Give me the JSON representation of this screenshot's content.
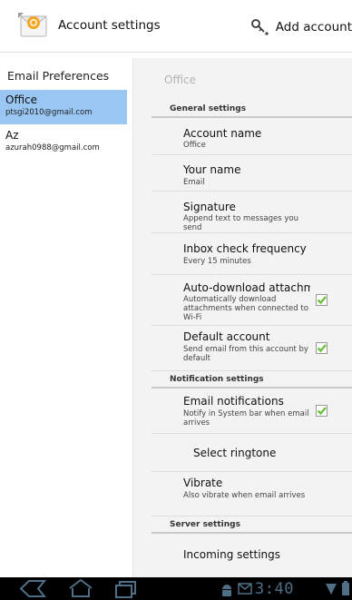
{
  "action_bar": {
    "title": "Account settings",
    "add_account_label": "Add account",
    "app_icon": "email-app-icon",
    "add_icon": "key-plus-icon"
  },
  "sidebar": {
    "heading": "Email Preferences",
    "accounts": [
      {
        "name": "Office",
        "email": "ptsgi2010@gmail.com",
        "selected": true
      },
      {
        "name": "Az",
        "email": "azurah0988@gmail.com",
        "selected": false
      }
    ]
  },
  "settings": {
    "pane_title": "Office",
    "general_header": "General settings",
    "account_name": {
      "title": "Account name",
      "summary": "Office"
    },
    "your_name": {
      "title": "Your name",
      "summary": "Email"
    },
    "signature": {
      "title": "Signature",
      "summary": "Append text to messages you send"
    },
    "inbox_check": {
      "title": "Inbox check frequency",
      "summary": "Every 15 minutes"
    },
    "auto_download": {
      "title": "Auto-download attachm",
      "summary": "Automatically download attachments when connected to Wi-Fi",
      "checked": true
    },
    "default_account": {
      "title": "Default account",
      "summary": "Send email from this account by default",
      "checked": true
    },
    "notification_header": "Notification settings",
    "email_notifications": {
      "title": "Email notifications",
      "summary": "Notify in System bar when email arrives",
      "checked": true
    },
    "select_ringtone": {
      "title": "Select ringtone"
    },
    "vibrate": {
      "title": "Vibrate",
      "summary": "Also vibrate when email arrives"
    },
    "server_header": "Server settings",
    "incoming": {
      "title": "Incoming settings"
    }
  },
  "nav_bar": {
    "time": "3:40",
    "icons": [
      "back-icon",
      "home-icon",
      "recent-apps-icon",
      "android-notification-icon",
      "mail-notification-icon",
      "wifi-icon",
      "battery-icon"
    ]
  },
  "colors": {
    "selected_row": "#99c6f2",
    "pane_background": "#f3f3f3",
    "checkbox_green": "#6bc13a",
    "clock": "#4f6f86"
  }
}
